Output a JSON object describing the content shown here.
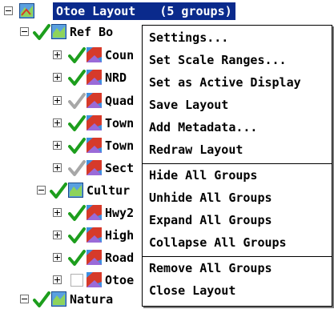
{
  "tree": {
    "root": {
      "label": "Otoe Layout",
      "groups_note": "(5 groups)"
    },
    "groups": [
      {
        "label": "Ref Bo",
        "layers": [
          "Coun",
          "NRD",
          "Quad",
          "Town",
          "Town",
          "Sect"
        ]
      },
      {
        "label": "Cultur",
        "layers": [
          "Hwy2",
          "High",
          "Road",
          "Otoe"
        ]
      },
      {
        "label": "Natura"
      }
    ]
  },
  "context_menu": {
    "items": [
      "Settings...",
      "Set Scale Ranges...",
      "Set as Active Display",
      "Save Layout",
      "Add Metadata...",
      "Redraw Layout",
      "Hide All Groups",
      "Unhide All Groups",
      "Expand All Groups",
      "Collapse All Groups",
      "Remove All Groups",
      "Close Layout"
    ]
  },
  "colors": {
    "selection": "#0a2a8c",
    "check_green": "#1d9e1d",
    "check_gray": "#a7a7a7"
  }
}
